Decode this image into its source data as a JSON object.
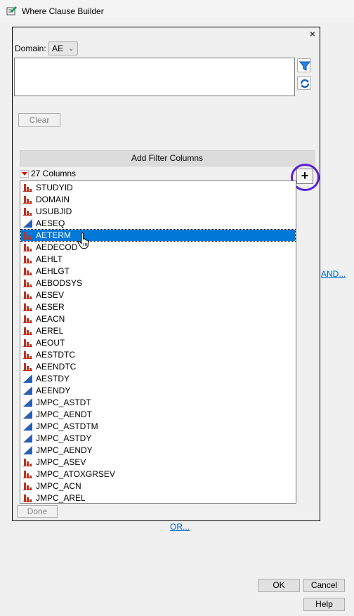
{
  "window": {
    "title": "Where Clause Builder"
  },
  "panel": {
    "close_glyph": "×",
    "domain_label": "Domain:",
    "domain_value": "AE",
    "where_text": "",
    "clear_label": "Clear",
    "add_filter_label": "Add Filter Columns",
    "columns_count_label": "27 Columns",
    "plus_glyph": "+",
    "done_label": "Done",
    "columns": [
      {
        "name": "STUDYID",
        "type": "nominal"
      },
      {
        "name": "DOMAIN",
        "type": "nominal"
      },
      {
        "name": "USUBJID",
        "type": "nominal"
      },
      {
        "name": "AESEQ",
        "type": "continuous"
      },
      {
        "name": "AETERM",
        "type": "nominal",
        "selected": true
      },
      {
        "name": "AEDECOD",
        "type": "nominal"
      },
      {
        "name": "AEHLT",
        "type": "nominal"
      },
      {
        "name": "AEHLGT",
        "type": "nominal"
      },
      {
        "name": "AEBODSYS",
        "type": "nominal"
      },
      {
        "name": "AESEV",
        "type": "nominal"
      },
      {
        "name": "AESER",
        "type": "nominal"
      },
      {
        "name": "AEACN",
        "type": "nominal"
      },
      {
        "name": "AEREL",
        "type": "nominal"
      },
      {
        "name": "AEOUT",
        "type": "nominal"
      },
      {
        "name": "AESTDTC",
        "type": "nominal"
      },
      {
        "name": "AEENDTC",
        "type": "nominal"
      },
      {
        "name": "AESTDY",
        "type": "continuous"
      },
      {
        "name": "AEENDY",
        "type": "continuous"
      },
      {
        "name": "JMPC_ASTDT",
        "type": "continuous"
      },
      {
        "name": "JMPC_AENDT",
        "type": "continuous"
      },
      {
        "name": "JMPC_ASTDTM",
        "type": "continuous"
      },
      {
        "name": "JMPC_ASTDY",
        "type": "continuous"
      },
      {
        "name": "JMPC_AENDY",
        "type": "continuous"
      },
      {
        "name": "JMPC_ASEV",
        "type": "nominal"
      },
      {
        "name": "JMPC_ATOXGRSEV",
        "type": "nominal"
      },
      {
        "name": "JMPC_ACN",
        "type": "nominal"
      },
      {
        "name": "JMPC_AREL",
        "type": "nominal"
      }
    ]
  },
  "links": {
    "and_label": "AND...",
    "or_label": "OR..."
  },
  "buttons": {
    "ok": "OK",
    "cancel": "Cancel",
    "help": "Help"
  },
  "colors": {
    "nominal_icon": "#c0321e",
    "continuous_icon": "#2a5fb0",
    "selection": "#0078d7",
    "highlight_ring": "#5a21d8"
  }
}
